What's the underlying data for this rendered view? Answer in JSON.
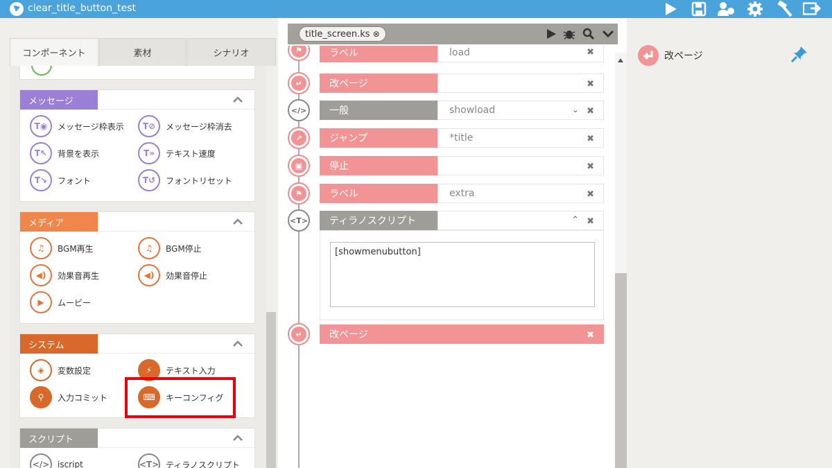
{
  "app": {
    "title": "clear_title_button_test"
  },
  "toolbar_icons": [
    "play-icon",
    "save-icon",
    "users-icon",
    "gear-icon",
    "hammer-icon",
    "export-icon"
  ],
  "left_tabs": [
    {
      "label": "コンポーネント",
      "active": true
    },
    {
      "label": "素材",
      "active": false
    },
    {
      "label": "シナリオ",
      "active": false
    }
  ],
  "sections": {
    "message": {
      "title": "メッセージ",
      "color": "#9b7fd6",
      "items": [
        "メッセージ枠表示",
        "メッセージ枠消去",
        "背景を表示",
        "テキスト速度",
        "フォント",
        "フォントリセット"
      ]
    },
    "media": {
      "title": "メディア",
      "color": "#f0864a",
      "items": [
        "BGM再生",
        "BGM停止",
        "効果音再生",
        "効果音停止",
        "ムービー"
      ]
    },
    "system": {
      "title": "システム",
      "color": "#d8692a",
      "items": [
        "変数設定",
        "テキスト入力",
        "入力コミット",
        "キーコンフィグ"
      ]
    },
    "script": {
      "title": "スクリプト",
      "color": "#9f9d98",
      "items": [
        "iscript",
        "ティラノスクリプト"
      ]
    }
  },
  "editor": {
    "file_tab": "title_screen.ks",
    "rows": [
      {
        "label": "ラベル",
        "value": "load",
        "color": "pink"
      },
      {
        "label": "改ページ",
        "value": "",
        "color": "pink"
      },
      {
        "label": "一般",
        "value": "showload",
        "color": "gray"
      },
      {
        "label": "ジャンプ",
        "value": "*title",
        "color": "pink"
      },
      {
        "label": "停止",
        "value": "",
        "color": "pink"
      },
      {
        "label": "ラベル",
        "value": "extra",
        "color": "pink"
      },
      {
        "label": "ティラノスクリプト",
        "value": "",
        "color": "gray"
      },
      {
        "label": "改ページ",
        "value": "",
        "color": "pink"
      }
    ],
    "script_content": "[showmenubutton]"
  },
  "right_panel": {
    "item_label": "改ページ"
  }
}
